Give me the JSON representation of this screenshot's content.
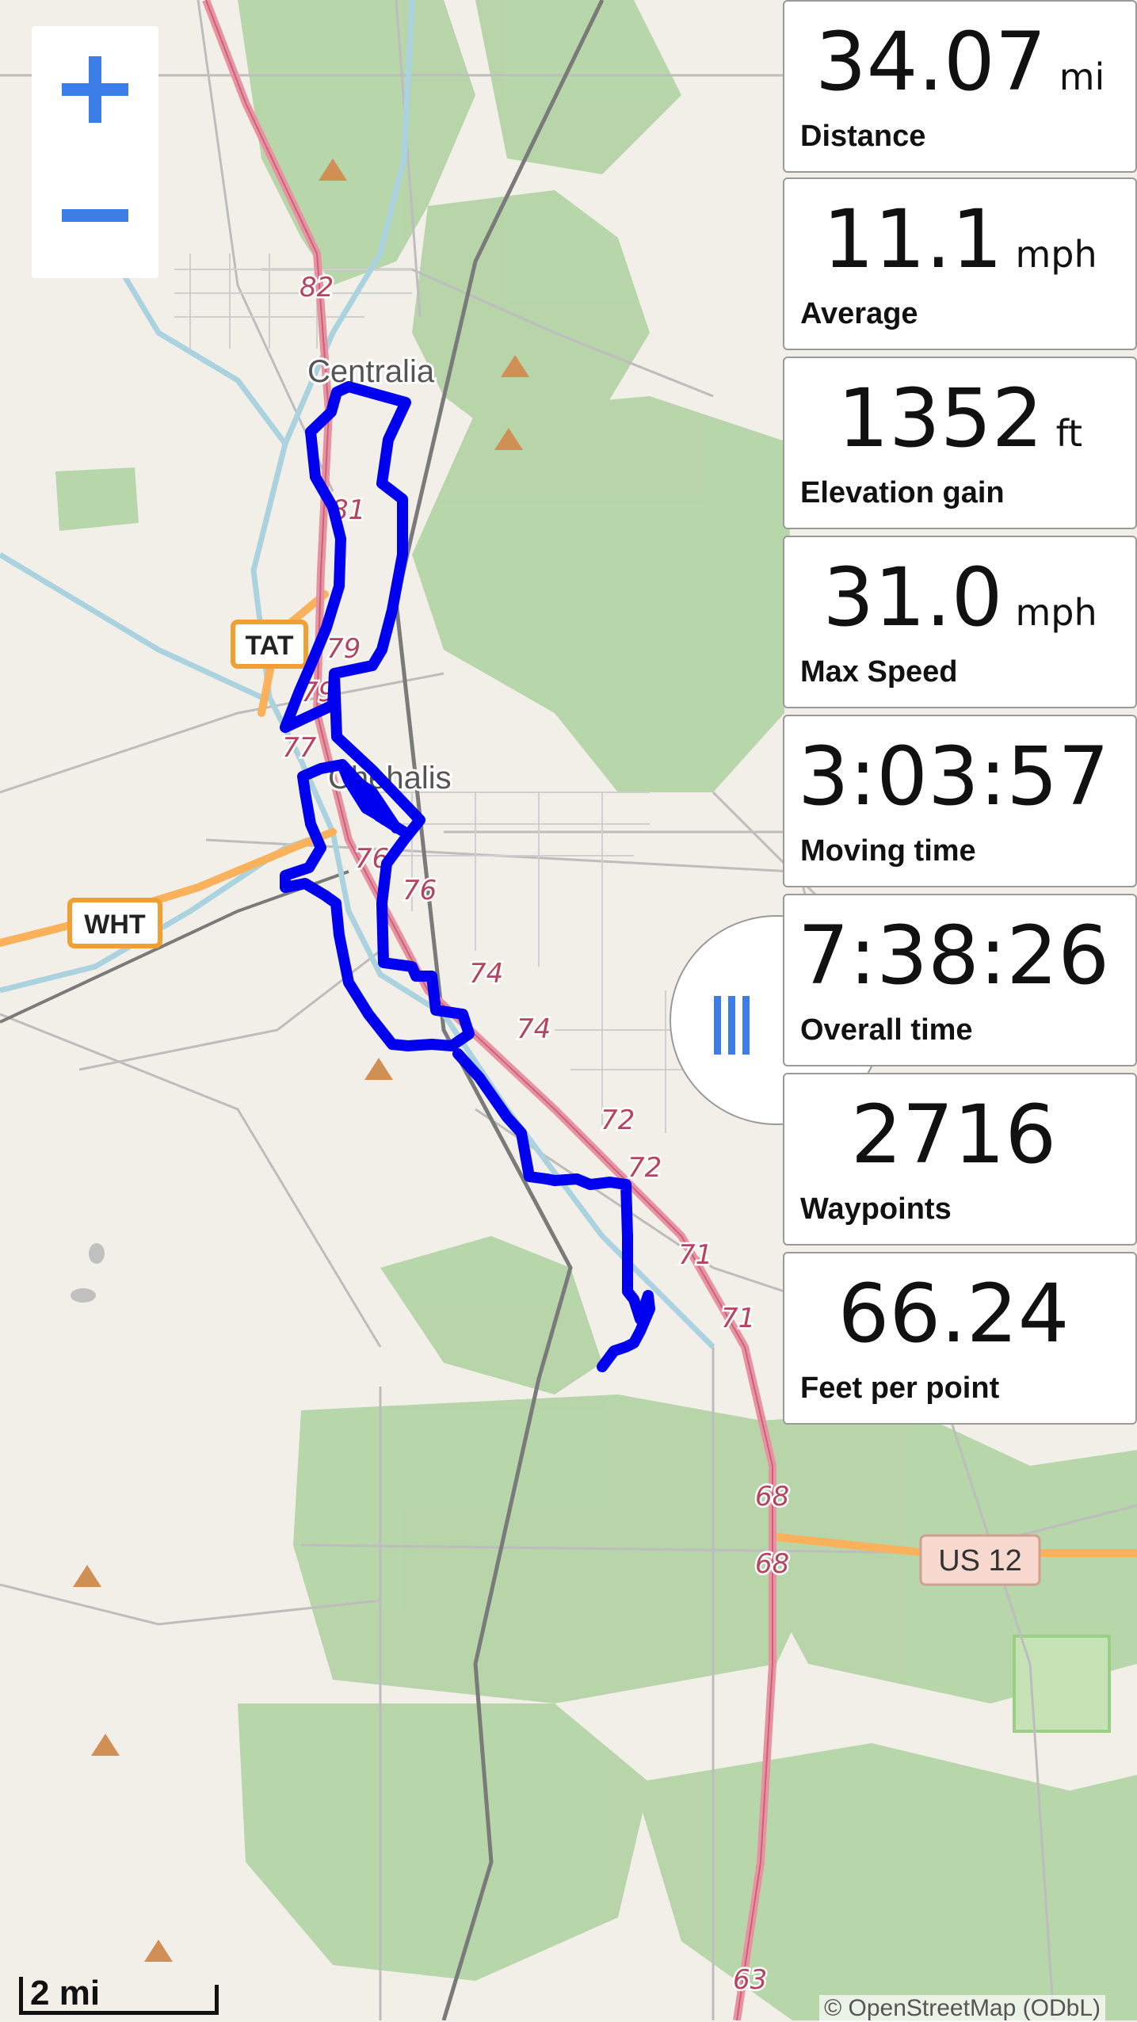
{
  "map": {
    "place_labels": [
      "Centralia",
      "Chehalis"
    ],
    "highway_shields": [
      "TAT",
      "WHT",
      "US 12"
    ],
    "exit_numbers": [
      "82",
      "81",
      "79",
      "79",
      "77",
      "76",
      "76",
      "74",
      "74",
      "72",
      "72",
      "71",
      "71",
      "68",
      "68",
      "63"
    ],
    "colors": {
      "background": "#f2efe9",
      "forest": "#add19e",
      "water": "#aad3df",
      "motorway": "#e892a2",
      "trunk": "#f9b25b",
      "track": "#0000ee"
    }
  },
  "zoom": {
    "in_icon": "plus-icon",
    "out_icon": "minus-icon"
  },
  "stats": [
    {
      "value": "34.07",
      "unit": "mi",
      "label": "Distance"
    },
    {
      "value": "11.1",
      "unit": "mph",
      "label": "Average"
    },
    {
      "value": "1352",
      "unit": "ft",
      "label": "Elevation gain"
    },
    {
      "value": "31.0",
      "unit": "mph",
      "label": "Max Speed"
    },
    {
      "value": "3:03:57",
      "unit": "",
      "label": "Moving time"
    },
    {
      "value": "7:38:26",
      "unit": "",
      "label": "Overall time"
    },
    {
      "value": "2716",
      "unit": "",
      "label": "Waypoints"
    },
    {
      "value": "66.24",
      "unit": "",
      "label": "Feet per point"
    }
  ],
  "panel_handle": {
    "icon": "drag-handle-icon"
  },
  "scale": {
    "label": "2 mi"
  },
  "attribution": "© OpenStreetMap (ODbL)"
}
